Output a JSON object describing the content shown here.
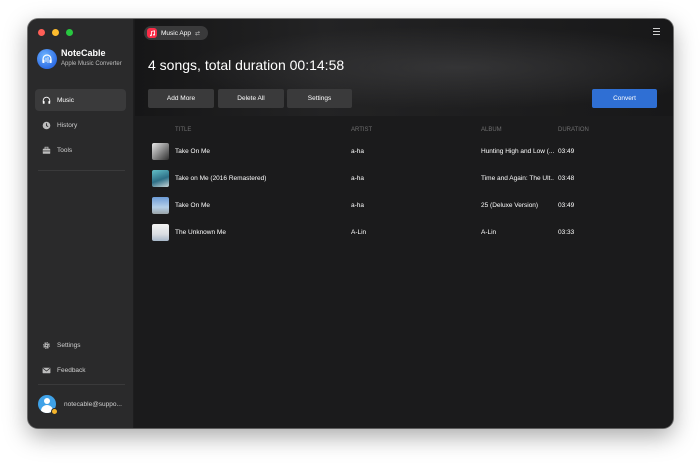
{
  "app": {
    "name": "NoteCable",
    "subtitle": "Apple Music Converter"
  },
  "sidebar": {
    "items": [
      {
        "label": "Music",
        "icon": "headphones-icon",
        "active": true
      },
      {
        "label": "History",
        "icon": "clock-icon",
        "active": false
      },
      {
        "label": "Tools",
        "icon": "toolbox-icon",
        "active": false
      }
    ],
    "bottom_items": [
      {
        "label": "Settings",
        "icon": "gear-icon"
      },
      {
        "label": "Feedback",
        "icon": "mail-icon"
      }
    ],
    "user_email": "notecable@suppo..."
  },
  "source": {
    "label": "Music App",
    "swap_glyph": "⇄"
  },
  "header": {
    "headline": "4 songs, total duration 00:14:58"
  },
  "toolbar": {
    "add_more": "Add More",
    "delete_all": "Delete All",
    "settings": "Settings",
    "convert": "Convert"
  },
  "table": {
    "columns": {
      "title": "TITLE",
      "artist": "ARTIST",
      "album": "ALBUM",
      "duration": "DURATION"
    },
    "rows": [
      {
        "title": "Take On Me",
        "artist": "a-ha",
        "album": "Hunting High and Low (...",
        "duration": "03:49"
      },
      {
        "title": "Take on Me (2016 Remastered)",
        "artist": "a-ha",
        "album": "Time and Again: The Ult...",
        "duration": "03:48"
      },
      {
        "title": "Take On Me",
        "artist": "a-ha",
        "album": "25 (Deluxe Version)",
        "duration": "03:49"
      },
      {
        "title": "The Unknown Me",
        "artist": "A-Lin",
        "album": "A-Lin",
        "duration": "03:33"
      }
    ]
  },
  "colors": {
    "accent": "#2f6fd4",
    "background": "#1b1b1c",
    "sidebar": "#2a2a2b",
    "music_app": "#fa2d48"
  }
}
